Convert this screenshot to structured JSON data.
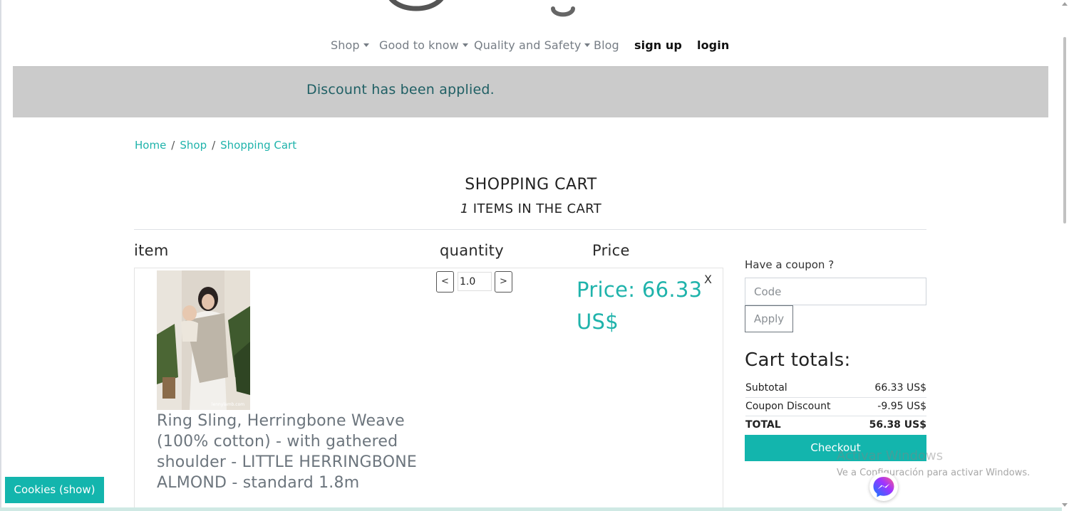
{
  "nav": {
    "items": [
      {
        "label": "Shop",
        "dropdown": true
      },
      {
        "label": "Good to know",
        "dropdown": true
      },
      {
        "label": "Quality and Safety",
        "dropdown": true
      },
      {
        "label": "Blog",
        "dropdown": false
      },
      {
        "label": "sign up",
        "dropdown": false
      },
      {
        "label": "login",
        "dropdown": false
      }
    ]
  },
  "alert": {
    "message": "Discount has been applied."
  },
  "breadcrumb": [
    "Home",
    "Shop",
    "Shopping Cart"
  ],
  "cart": {
    "title": "SHOPPING CART",
    "count": "1",
    "count_suffix": " ITEMS IN THE CART",
    "columns": {
      "item": "item",
      "quantity": "quantity",
      "price": "Price"
    }
  },
  "item": {
    "name": "Ring Sling, Herringbone Weave (100% cotton) - with gathered shoulder - LITTLE HERRINGBONE ALMOND - standard 1.8m",
    "quantity": "1.0",
    "decrement_label": "<",
    "increment_label": ">",
    "price": "Price: 66.33 US$",
    "remove_label": "X",
    "image_watermark": "lennylamb.com",
    "icon": "product-photo"
  },
  "coupon": {
    "label": "Have a coupon ?",
    "placeholder": "Code",
    "apply_label": "Apply"
  },
  "totals": {
    "title": "Cart totals:",
    "rows": [
      {
        "label": "Subtotal",
        "value": "66.33 US$"
      },
      {
        "label": "Coupon Discount",
        "value": "-9.95 US$"
      },
      {
        "label": "TOTAL",
        "value": "56.38 US$"
      }
    ],
    "checkout_label": "Checkout"
  },
  "watermark": {
    "line1": "Activar Windows",
    "line2": "Ve a Configuración para activar Windows."
  },
  "cookies": {
    "label": "Cookies (show)"
  },
  "icons": {
    "messenger": "messenger-icon",
    "caret": "caret-down-icon"
  },
  "colors": {
    "accent": "#13b5ad",
    "alert_bg": "#cbcbcb",
    "alert_text": "#1f5f64"
  }
}
